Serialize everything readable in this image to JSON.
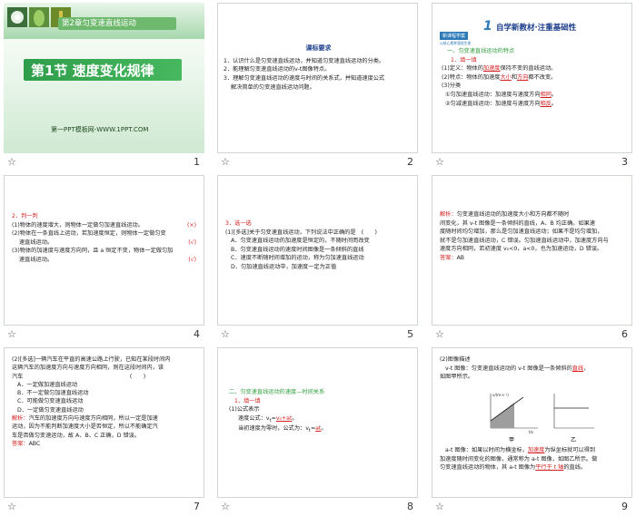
{
  "slides": [
    {
      "num": "1",
      "chapter": "第2章匀变速直线运动",
      "title": "第1节 速度变化规律",
      "footer": "第一PPT模板网-WWW.1PPT.COM"
    },
    {
      "num": "2",
      "title": "课标要求",
      "lines": [
        "1．认识什么是匀变速直线运动，并知道匀变速直线运动的分类。",
        "2．能理解匀变速直线运动的v-t图像特点。",
        "3．理解匀变速直线运动的速度与时间的关系式，并知道速度公式",
        "解决简单的匀变速直线运动问题。"
      ]
    },
    {
      "num": "3",
      "badge_top": "新课程学案",
      "badge_bottom": "以核心素养落地生根",
      "big_number": "1",
      "title": "自学新教材·注重基础性",
      "h1": "一、匀变速直线运动的特点",
      "h2": "1．填一填",
      "l1a": "(1)定义：物体的",
      "b1": "加速度",
      "l1b": "保持不变的直线运动。",
      "l2a": "(2)特点：物体的加速度",
      "b2": "大小",
      "l2b": "和",
      "b3": "方向",
      "l2c": "都不改变。",
      "l3": "(3)分类",
      "l4a": "①匀加速直线运动：加速度与速度方向",
      "b4": "相同",
      "l4b": "。",
      "l5a": "②匀减速直线运动：加速度与速度方向",
      "b5": "相反",
      "l5b": "。"
    },
    {
      "num": "4",
      "h": "2．判一判",
      "items": [
        [
          "(1)物体的速度增大，则物体一定做匀加速直线运动。",
          "(×)"
        ],
        [
          "(2)物体在一条直线上运动，若加速度恒定，则物体一定做匀变",
          ""
        ],
        [
          "速直线运动。",
          "(√)"
        ],
        [
          "(3)物体的加速度与速度方向同，且 a 恒定不变，物体一定做匀加",
          ""
        ],
        [
          "速直线运动。",
          "(√)"
        ]
      ]
    },
    {
      "num": "5",
      "h": "3．选一选",
      "lines": [
        "(1)[多选]关于匀变速直线运动，下列说法中正确的是　(　　)",
        "A．匀变速直线运动的加速度是恒定的，不随时间而改变",
        "B．匀变速直线运动的速度时间图像是一条倾斜的直线",
        "C．速度不断随时间增加的运动，称为匀加速直线运动",
        "D．匀加速直线运动中，加速度一定为正值"
      ]
    },
    {
      "num": "6",
      "head": "解析：",
      "lines": [
        "匀变速直线运动的加速度大小和方向都不随时",
        "间变化，其 v-t 图像是一条倾斜的直线，A、B 均正确。如果速",
        "度随时间均匀增加，那么是匀加速直线运动；如果不是均匀增加，",
        "就不是匀加速直线运动，C 错误。匀加速直线运动中，加速度方向与",
        "速度方向相同，若初速度 v₀<0，a<0，也为加速运动，D 错误。"
      ],
      "ans_label": "答案：",
      "ans": "AB"
    },
    {
      "num": "7",
      "lines": [
        "(2)[多选]一辆汽车在平直的高速公路上行驶，已知在某段时间内",
        "这辆汽车的加速度方向与速度方向相同，则在这段时间内，该",
        "汽车　　　　　　　　　　　　　　　　　　　(　　)",
        "A．一定做加速直线运动",
        "B．不一定做匀加速直线运动",
        "C．可能做匀变速直线运动",
        "D．一定做匀变速直线运动"
      ],
      "exp_label": "解析：",
      "exp": [
        "汽车的加速度方向与速度方向相同，所以一定是加速",
        "运动，因为不能判断加速度大小是否恒定，所以不能确定汽",
        "车是否做匀变速运动，故 A、B、C 正确，D 错误。"
      ],
      "ans_label": "答案：",
      "ans": "ABC"
    },
    {
      "num": "8",
      "h1": "二、匀变速直线运动的速度—时间关系",
      "h2": "1．填一填",
      "l1": "(1)公式表示",
      "l2a": "速度公式：v",
      "l2b": "t",
      "l2c": "=",
      "b1": "v₀+at",
      "l2d": "。",
      "l3a": "当初速度为零时，公式为：v",
      "l3b": "t",
      "l3c": "=",
      "b2": "at",
      "l3d": "。"
    },
    {
      "num": "9",
      "l1": "(2)图像描述",
      "l2a": "v-t 图像：匀变速直线运动的 v-t 图像是一条倾斜的",
      "b1": "直线",
      "l2b": "，",
      "l3": "如图甲所示。",
      "g1_y": "v/(m·s⁻¹)",
      "g1_x": "t/s",
      "g1_cap": "甲",
      "g2_cap": "乙",
      "l4a": "a-t 图像：如果以时间为横坐标，",
      "b2": "加速度",
      "l4b": "为纵坐标就可以得到",
      "l5": "加速度随时间变化的图像，通常称为 a-t 图像，如图乙所示。做",
      "l6a": "匀变速直线运动的物体，其 a-t 图像为",
      "b3": "平行于 t 轴",
      "l6b": "的直线。"
    }
  ]
}
